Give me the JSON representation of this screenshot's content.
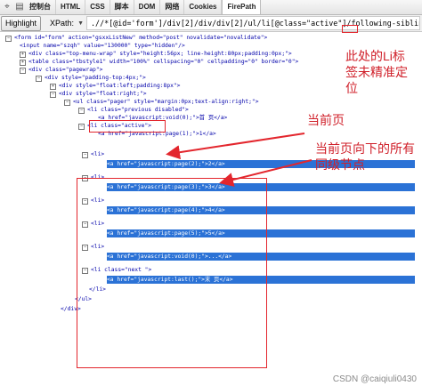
{
  "toolbar": {
    "tabs": [
      "控制台",
      "HTML",
      "CSS",
      "脚本",
      "DOM",
      "网络",
      "Cookies",
      "FirePath"
    ],
    "active_tab": "FirePath"
  },
  "xpath_bar": {
    "highlight_label": "Highlight",
    "xpath_label": "XPath:",
    "xpath_value": ".//*[@id='form']/div[2]/div/div[2]/ul/li[@class=\"active\"]/following-sibling::li/a"
  },
  "code_lines": [
    "<form id=\"form\" action=\"gsxxListNew\" method=\"post\" novalidate=\"novalidate\">",
    "<input name=\"szqh\" value=\"130000\" type=\"hidden\"/>",
    "<div class=\"top-menu-wrap\" style=\"height:56px; line-height:80px;padding:0px;\">",
    "<table class=\"tbstyle1\" width=\"100%\" cellspacing=\"0\" cellpadding=\"0\" border=\"0\">",
    "<div class=\"pagewrap\">",
    "<div style=\"padding-top:4px;\">",
    "<div style=\"float:left;padding:8px\">",
    "<div style=\"float:right;\">",
    "<ul class=\"pager\" style=\"margin:0px;text-align:right;\">",
    "<li class=\"previous disabled\">",
    "<a href=\"javascript:void(0);\">首 页</a>",
    "<li class=\"active\">",
    "<a href=\"javascript:page(1);\">1</a>",
    "<li>",
    "<a href=\"javascript:page(2);\">2</a>",
    "<li>",
    "<a href=\"javascript:page(3);\">3</a>",
    "<li>",
    "<a href=\"javascript:page(4);\">4</a>",
    "<li>",
    "<a href=\"javascript:page(5);\">5</a>",
    "<li>",
    "<a href=\"javascript:void(0);\">...</a>",
    "<li class=\"next \">",
    "<a href=\"javascript:last();\">末 页</a>",
    "</li>",
    "</ul>",
    "</div>"
  ],
  "annotations": {
    "li_note": "此处的Li标签未精准定位",
    "current_page": "当前页",
    "siblings_note": "当前页向下的所有同级节点"
  },
  "watermark": "CSDN @caiqiuli0430"
}
